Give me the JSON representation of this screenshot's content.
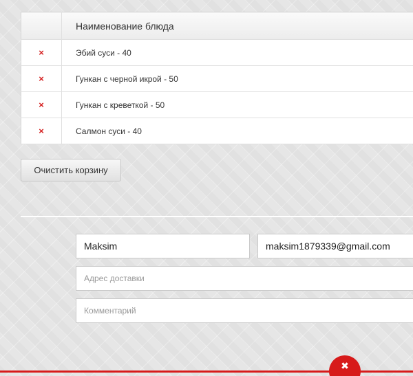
{
  "cart": {
    "header_delete": "",
    "header_name": "Наименование блюда",
    "delete_symbol": "×",
    "items": [
      {
        "name": "Эбий суси - 40"
      },
      {
        "name": "Гункан с черной икрой - 50"
      },
      {
        "name": "Гункан с креветкой - 50"
      },
      {
        "name": "Салмон суси - 40"
      }
    ],
    "clear_label": "Очистить корзину"
  },
  "form": {
    "name_value": "Maksim",
    "email_value": "maksim1879339@gmail.com",
    "address_placeholder": "Адрес доставки",
    "comment_placeholder": "Комментарий"
  },
  "footer": {
    "close_symbol": "✖"
  },
  "colors": {
    "accent": "#d71a1a",
    "delete": "#d41d1d"
  },
  "icons": {
    "delete": "close-icon",
    "footer_close": "close-icon"
  }
}
